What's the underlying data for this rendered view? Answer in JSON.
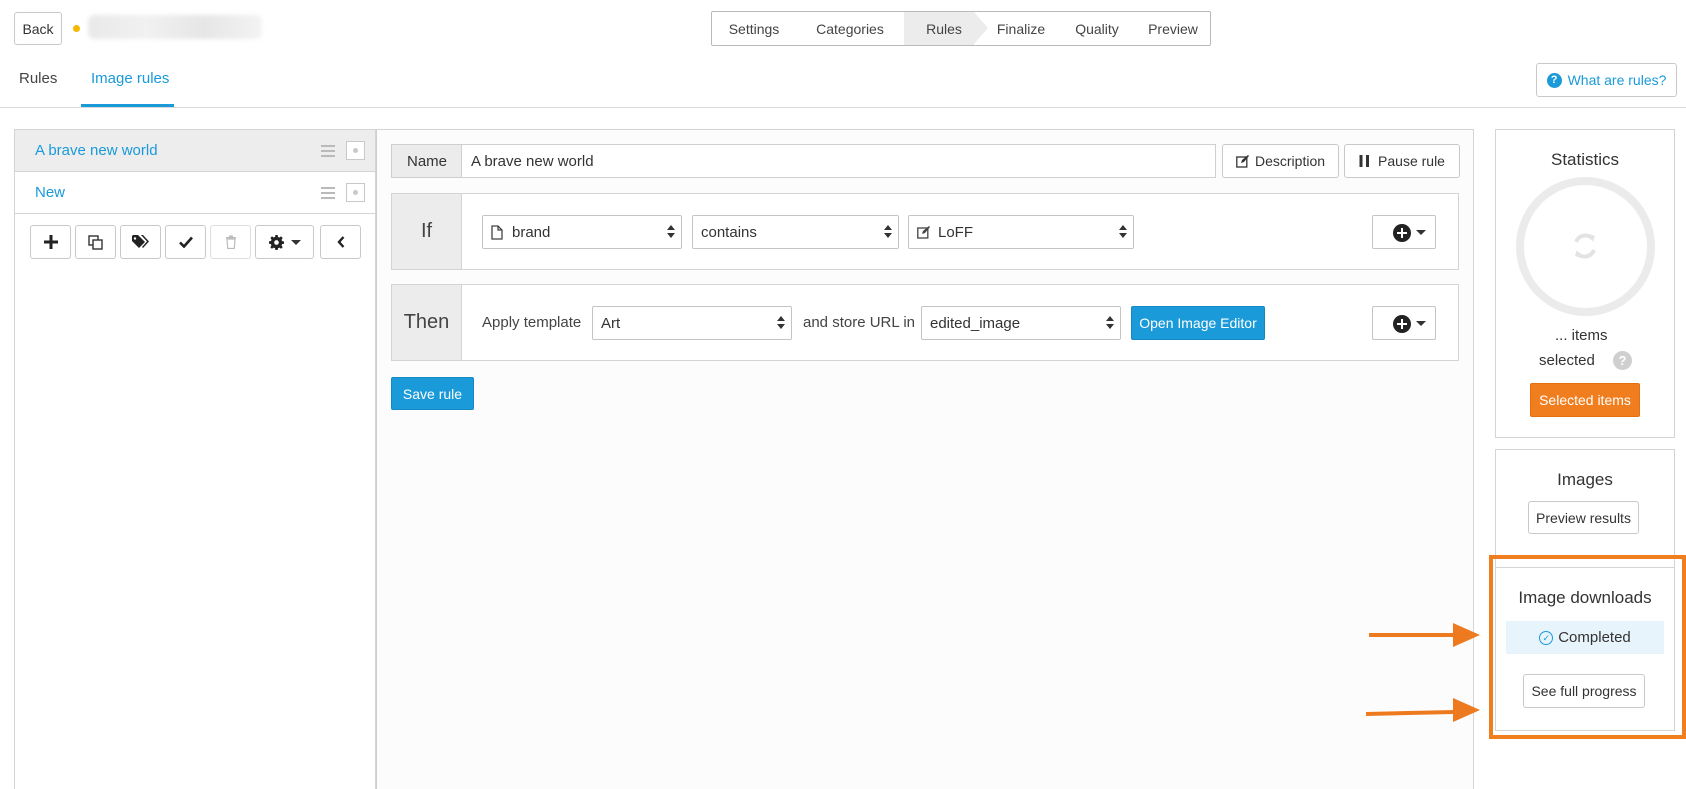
{
  "header": {
    "back_label": "Back",
    "steps": [
      "Settings",
      "Categories",
      "Rules",
      "Finalize",
      "Quality",
      "Preview"
    ],
    "active_step": "Rules"
  },
  "tabs": {
    "rules": "Rules",
    "image_rules": "Image rules",
    "help_label": "What are rules?"
  },
  "rule_list": {
    "items": [
      {
        "label": "A brave new world",
        "selected": true
      },
      {
        "label": "New",
        "selected": false
      }
    ],
    "toolbar_icons": [
      "plus-icon",
      "copy-icon",
      "tags-icon",
      "check-icon",
      "trash-icon",
      "gear-icon",
      "chevron-left-icon"
    ]
  },
  "editor": {
    "name_label": "Name",
    "name_value": "A brave new world",
    "description_label": "Description",
    "pause_label": "Pause rule",
    "if_label": "If",
    "condition": {
      "field": "brand",
      "operator": "contains",
      "value": "LoFF"
    },
    "then_label": "Then",
    "action": {
      "apply_label": "Apply template",
      "template": "Art",
      "store_label": "and store URL in",
      "store_field": "edited_image",
      "open_editor_label": "Open Image Editor"
    },
    "save_label": "Save rule"
  },
  "statistics": {
    "title": "Statistics",
    "items_line1": "... items",
    "items_line2": "selected",
    "help_glyph": "?",
    "selected_items_label": "Selected items"
  },
  "images": {
    "title": "Images",
    "preview_label": "Preview results"
  },
  "downloads": {
    "title": "Image downloads",
    "status": "Completed",
    "progress_label": "See full progress"
  },
  "colors": {
    "accent_blue": "#1a9ad9",
    "accent_orange": "#f07d1e",
    "status_bg": "#e8f4fb",
    "dot_yellow": "#f5b800"
  }
}
